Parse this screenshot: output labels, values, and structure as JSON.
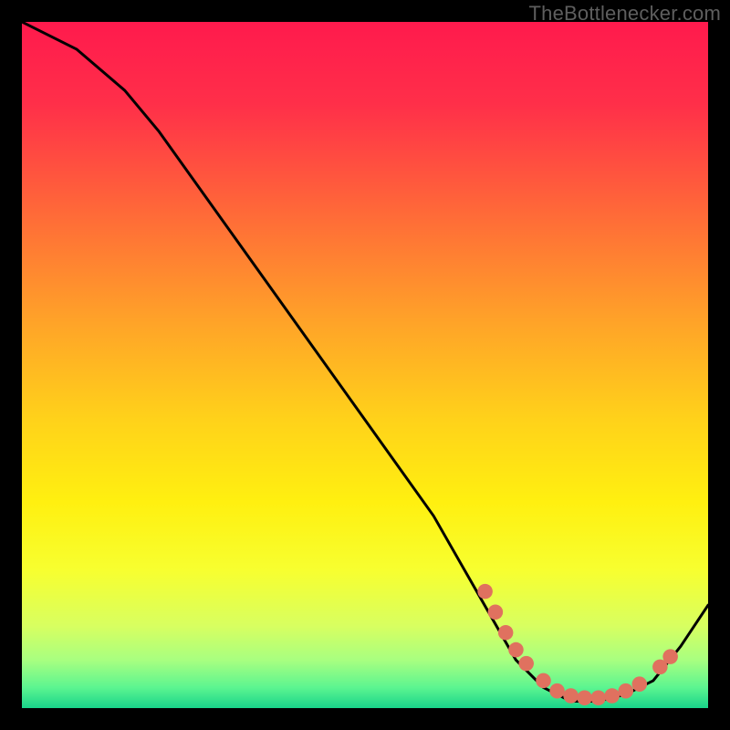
{
  "watermark": "TheBottlenecker.com",
  "chart_data": {
    "type": "line",
    "title": "",
    "xlabel": "",
    "ylabel": "",
    "xlim": [
      0,
      100
    ],
    "ylim": [
      0,
      100
    ],
    "series": [
      {
        "name": "curve",
        "x": [
          0,
          8,
          15,
          20,
          30,
          40,
          50,
          60,
          68,
          72,
          76,
          80,
          84,
          88,
          92,
          96,
          100
        ],
        "y": [
          100,
          96,
          90,
          84,
          70,
          56,
          42,
          28,
          14,
          7,
          3,
          1,
          1,
          2,
          4,
          9,
          15
        ]
      }
    ],
    "markers": [
      {
        "x": 67.5,
        "y": 17.0
      },
      {
        "x": 69.0,
        "y": 14.0
      },
      {
        "x": 70.5,
        "y": 11.0
      },
      {
        "x": 72.0,
        "y": 8.5
      },
      {
        "x": 73.5,
        "y": 6.5
      },
      {
        "x": 76.0,
        "y": 4.0
      },
      {
        "x": 78.0,
        "y": 2.5
      },
      {
        "x": 80.0,
        "y": 1.8
      },
      {
        "x": 82.0,
        "y": 1.5
      },
      {
        "x": 84.0,
        "y": 1.5
      },
      {
        "x": 86.0,
        "y": 1.8
      },
      {
        "x": 88.0,
        "y": 2.5
      },
      {
        "x": 90.0,
        "y": 3.5
      },
      {
        "x": 93.0,
        "y": 6.0
      },
      {
        "x": 94.5,
        "y": 7.5
      }
    ],
    "gradient_stops": [
      {
        "pos": 0.0,
        "color": "#ff1a4d"
      },
      {
        "pos": 0.12,
        "color": "#ff2f49"
      },
      {
        "pos": 0.28,
        "color": "#ff6a38"
      },
      {
        "pos": 0.44,
        "color": "#ffa428"
      },
      {
        "pos": 0.58,
        "color": "#ffd21a"
      },
      {
        "pos": 0.7,
        "color": "#fff010"
      },
      {
        "pos": 0.8,
        "color": "#f7ff30"
      },
      {
        "pos": 0.88,
        "color": "#d8ff60"
      },
      {
        "pos": 0.93,
        "color": "#a8ff80"
      },
      {
        "pos": 0.97,
        "color": "#5cf590"
      },
      {
        "pos": 1.0,
        "color": "#18d48a"
      }
    ],
    "marker_color": "#e0715f",
    "line_color": "#000000"
  }
}
